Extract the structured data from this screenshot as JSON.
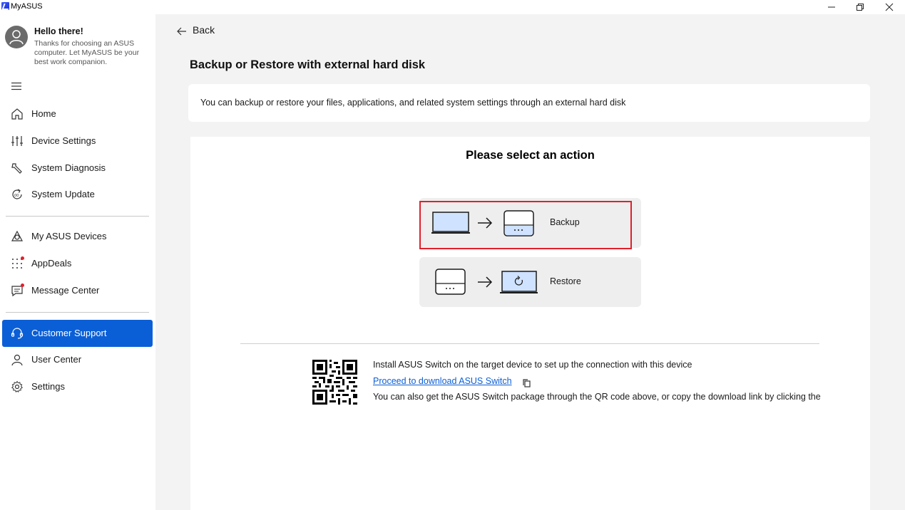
{
  "window": {
    "title": "MyASUS"
  },
  "sidebar": {
    "greeting": "Hello there!",
    "greeting_sub": "Thanks for choosing an ASUS computer. Let MyASUS be your best work companion.",
    "items": [
      {
        "label": "Home",
        "icon": "home-icon"
      },
      {
        "label": "Device Settings",
        "icon": "sliders-icon"
      },
      {
        "label": "System Diagnosis",
        "icon": "wrench-icon"
      },
      {
        "label": "System Update",
        "icon": "update-icon"
      },
      {
        "label": "My ASUS Devices",
        "icon": "devices-icon"
      },
      {
        "label": "AppDeals",
        "icon": "grid-dots-icon",
        "badge": true
      },
      {
        "label": "Message Center",
        "icon": "message-icon",
        "badge": true
      },
      {
        "label": "Customer Support",
        "icon": "headset-icon",
        "active": true
      },
      {
        "label": "User Center",
        "icon": "user-icon"
      },
      {
        "label": "Settings",
        "icon": "gear-icon"
      }
    ]
  },
  "main": {
    "back_label": "Back",
    "title": "Backup or Restore with external hard disk",
    "description": "You can backup or restore your files, applications, and related system settings through an external hard disk",
    "action_title": "Please select an action",
    "options": [
      {
        "label": "Backup",
        "selected": true
      },
      {
        "label": "Restore",
        "selected": false
      }
    ],
    "switch_info": "Install ASUS Switch on the target device to set up the connection with this device",
    "switch_link": "Proceed to download ASUS Switch",
    "switch_note": "You can also get the ASUS Switch package through the QR code above, or copy the download link by clicking the"
  },
  "colors": {
    "accent": "#0b5fd6",
    "badge": "#e0202b",
    "selection": "#e0202b",
    "screen_fill": "#cfe2ff"
  }
}
